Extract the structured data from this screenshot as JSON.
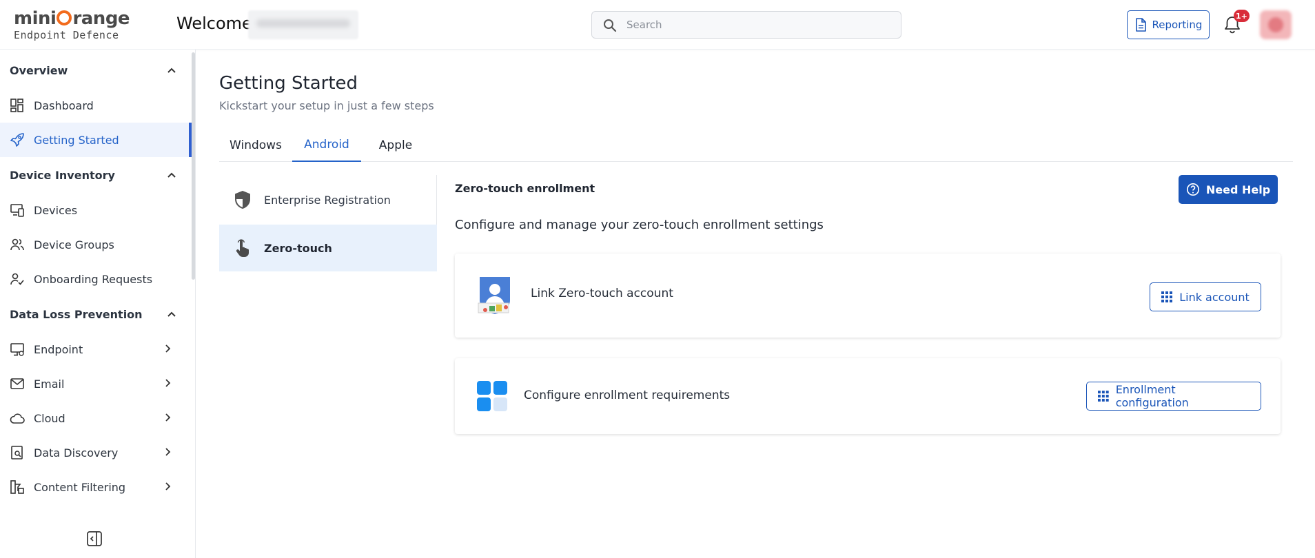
{
  "brand": {
    "logo_top": "mini",
    "logo_top_rest": "range",
    "logo_bottom": "Endpoint Defence",
    "accent": "#1a55b8",
    "logo_orange": "#f26b1d"
  },
  "header": {
    "welcome": "Welcome,",
    "search_placeholder": "Search",
    "reporting_label": "Reporting",
    "notification_count": "1+"
  },
  "sidebar": {
    "sections": [
      {
        "label": "Overview"
      },
      {
        "label": "Device Inventory"
      },
      {
        "label": "Data Loss Prevention"
      }
    ],
    "items": [
      {
        "label": "Dashboard",
        "icon": "dashboard-icon"
      },
      {
        "label": "Getting Started",
        "icon": "rocket-icon"
      },
      {
        "label": "Devices",
        "icon": "devices-icon"
      },
      {
        "label": "Device Groups",
        "icon": "users-icon"
      },
      {
        "label": "Onboarding Requests",
        "icon": "user-check-icon"
      },
      {
        "label": "Endpoint",
        "icon": "monitor-icon"
      },
      {
        "label": "Email",
        "icon": "mail-icon"
      },
      {
        "label": "Cloud",
        "icon": "cloud-icon"
      },
      {
        "label": "Data Discovery",
        "icon": "search-document-icon"
      },
      {
        "label": "Content Filtering",
        "icon": "filter-icon"
      }
    ]
  },
  "page": {
    "title": "Getting Started",
    "subtitle": "Kickstart your setup in just a few steps",
    "tabs": [
      {
        "label": "Windows"
      },
      {
        "label": "Android"
      },
      {
        "label": "Apple"
      }
    ],
    "subnav": [
      {
        "label": "Enterprise Registration",
        "icon": "shield-icon"
      },
      {
        "label": "Zero-touch",
        "icon": "hand-pointer-icon"
      }
    ]
  },
  "content": {
    "section_title": "Zero-touch enrollment",
    "need_help_label": "Need Help",
    "description": "Configure and manage your zero-touch enrollment settings",
    "cards": [
      {
        "label": "Link Zero-touch account",
        "button": "Link account",
        "icon": "zero-touch-account-icon"
      },
      {
        "label": "Configure enrollment requirements",
        "button": "Enrollment configuration",
        "icon": "app-grid-icon"
      }
    ]
  }
}
